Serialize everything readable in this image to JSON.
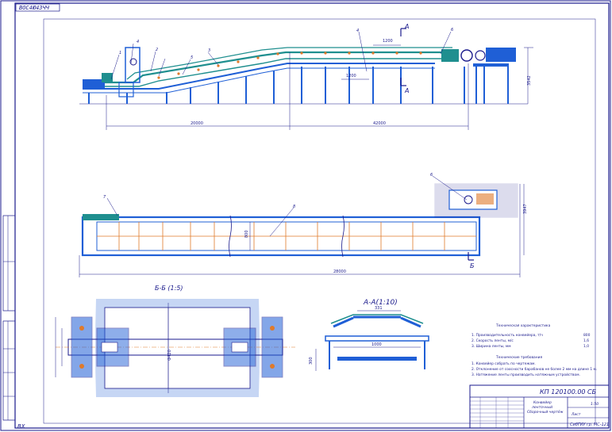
{
  "sheet": {
    "top_left_code": "ВОС4Ю4ЗЧЧ",
    "corner_mark": "ВХ"
  },
  "views": {
    "section_b": {
      "title": "Б-Б (1:5)",
      "dim_height": "Ф420"
    },
    "section_a": {
      "title": "А-А(1:10)",
      "dim_top": "331",
      "dim_width": "1000",
      "dim_side": "300"
    },
    "cut_a_label": "А",
    "cut_b_label": "Б",
    "main_dims": {
      "left": "20000",
      "right": "42000",
      "total": "28000",
      "height": "3542",
      "plan_height": "3947",
      "belt": "800",
      "span_top": "1200",
      "span_low": "1200"
    },
    "positions": [
      "1",
      "2",
      "3",
      "4",
      "5",
      "6",
      "7",
      "8"
    ]
  },
  "tech": {
    "title": "Техническая характеристика",
    "lines": [
      {
        "text": "1. Производительность конвейера, т/ч",
        "value": "800"
      },
      {
        "text": "2. Скорость ленты, м/с",
        "value": "1,6"
      },
      {
        "text": "3. Ширина ленты, мм",
        "value": "1,0"
      }
    ],
    "req_title": "Технические требования",
    "req_lines": [
      "1. Конвейер собрать по чертежам.",
      "2. Отклонение от соосности барабанов не более 2 мм на длине 1 м.",
      "3. Натяжение ленты производить натяжным устройством."
    ]
  },
  "title_block": {
    "doc_code": "КП 120100.00 СБ",
    "name_line1": "Конвейер",
    "name_line2": "ленточный",
    "name_line3": "Сборочный чертёж",
    "scale": "1:50",
    "sheet_label": "Лист",
    "org": "СибГИУ  гр. МС-121"
  },
  "colors": {
    "line": "#1a1a8c",
    "blue_fill": "#1f5fd6",
    "teal": "#1f8f8f",
    "orange": "#e07a2a"
  }
}
